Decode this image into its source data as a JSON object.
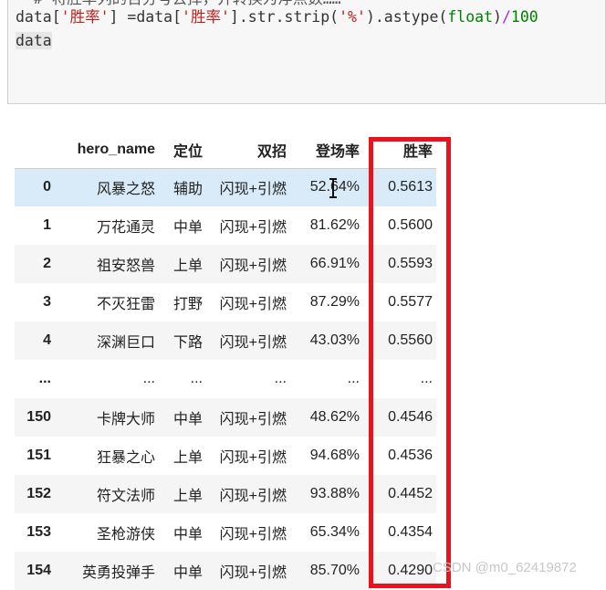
{
  "code": {
    "line0": "  # 将胜率列的百分号去掉，并转换为浮点数……",
    "line1_parts": [
      "data[",
      "'胜率'",
      "] =data[",
      "'胜率'",
      "].str.strip(",
      "'%'",
      ").astype(",
      "float",
      ")",
      "/",
      "100"
    ],
    "line2": "data"
  },
  "table": {
    "columns": [
      "",
      "hero_name",
      "定位",
      "双招",
      "登场率",
      "胜率"
    ],
    "rows": [
      {
        "index": "0",
        "hero_name": "风暴之怒",
        "position": "辅助",
        "skill": "闪现+引燃",
        "pick_rate": "52.64%",
        "win_rate": "0.5613"
      },
      {
        "index": "1",
        "hero_name": "万花通灵",
        "position": "中单",
        "skill": "闪现+引燃",
        "pick_rate": "81.62%",
        "win_rate": "0.5600"
      },
      {
        "index": "2",
        "hero_name": "祖安怒兽",
        "position": "上单",
        "skill": "闪现+引燃",
        "pick_rate": "66.91%",
        "win_rate": "0.5593"
      },
      {
        "index": "3",
        "hero_name": "不灭狂雷",
        "position": "打野",
        "skill": "闪现+引燃",
        "pick_rate": "87.29%",
        "win_rate": "0.5577"
      },
      {
        "index": "4",
        "hero_name": "深渊巨口",
        "position": "下路",
        "skill": "闪现+引燃",
        "pick_rate": "43.03%",
        "win_rate": "0.5560"
      },
      {
        "index": "...",
        "hero_name": "...",
        "position": "...",
        "skill": "...",
        "pick_rate": "...",
        "win_rate": "..."
      },
      {
        "index": "150",
        "hero_name": "卡牌大师",
        "position": "中单",
        "skill": "闪现+引燃",
        "pick_rate": "48.62%",
        "win_rate": "0.4546"
      },
      {
        "index": "151",
        "hero_name": "狂暴之心",
        "position": "上单",
        "skill": "闪现+引燃",
        "pick_rate": "94.68%",
        "win_rate": "0.4536"
      },
      {
        "index": "152",
        "hero_name": "符文法师",
        "position": "上单",
        "skill": "闪现+引燃",
        "pick_rate": "93.88%",
        "win_rate": "0.4452"
      },
      {
        "index": "153",
        "hero_name": "圣枪游侠",
        "position": "中单",
        "skill": "闪现+引燃",
        "pick_rate": "65.34%",
        "win_rate": "0.4354"
      },
      {
        "index": "154",
        "hero_name": "英勇投弹手",
        "position": "中单",
        "skill": "闪现+引燃",
        "pick_rate": "85.70%",
        "win_rate": "0.4290"
      }
    ],
    "hovered_row": 0
  },
  "highlight": {
    "color": "#e8141d",
    "column": "胜率"
  },
  "icons": {
    "cursor": "text-cursor-icon"
  },
  "watermark": "CSDN @m0_62419872"
}
